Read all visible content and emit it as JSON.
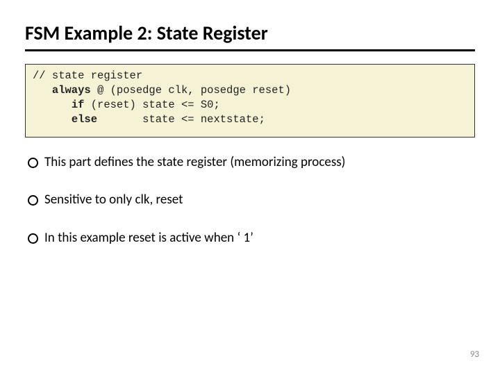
{
  "title": "FSM Example 2: State Register",
  "code": {
    "line1a": "// state register",
    "line2_pre": "   ",
    "line2_kw": "always",
    "line2_rest": " @ (posedge clk, posedge reset)",
    "line3_pre": "      ",
    "line3_kw": "if",
    "line3_rest": " (reset) state <= S0;",
    "line4_pre": "      ",
    "line4_kw": "else",
    "line4_rest": "       state <= nextstate;"
  },
  "bullets": [
    "This part defines the state register (memorizing process)",
    "Sensitive to only clk, reset",
    "In this example reset is active when ‘ 1’"
  ],
  "page": "93"
}
